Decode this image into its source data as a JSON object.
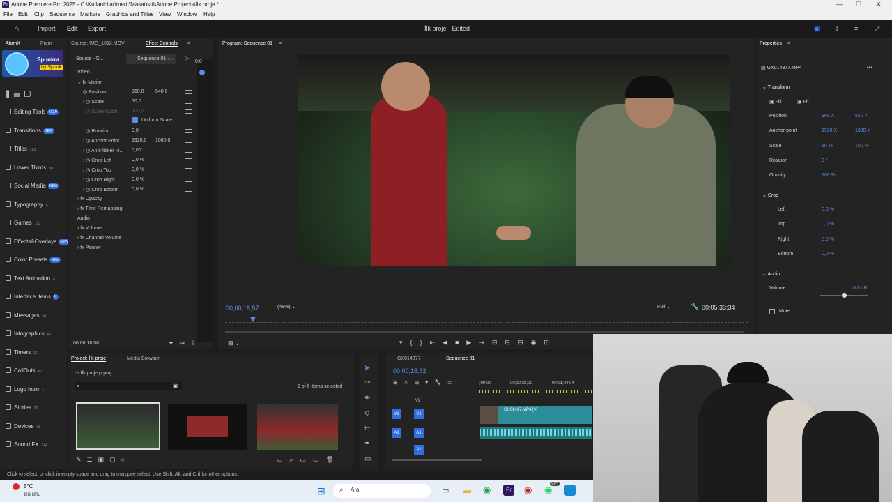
{
  "window": {
    "title": "Adobe Premiere Pro 2025 - C:\\Kullanicilar\\mertt\\Masaüstü\\Adobe Projects\\İlk proje *"
  },
  "menu": [
    "File",
    "Edit",
    "Clip",
    "Sequence",
    "Markers",
    "Graphics and Titles",
    "View",
    "Window",
    "Help"
  ],
  "header": {
    "import": "Import",
    "edit": "Edit",
    "export": "Export",
    "project_title": "İlk proje - Edited"
  },
  "atomx": {
    "tab": "AtomX",
    "tab2": "Prem",
    "banner_title": "Spunkra",
    "banner_sub": "by Spunk",
    "items": [
      {
        "label": "Editing Tools",
        "count": "",
        "badge": "NEW"
      },
      {
        "label": "Transitions",
        "count": "",
        "badge": "NEW"
      },
      {
        "label": "Titles",
        "count": "123",
        "badge": ""
      },
      {
        "label": "Lower Thirds",
        "count": "80",
        "badge": ""
      },
      {
        "label": "Social Media",
        "count": "",
        "badge": "NEW"
      },
      {
        "label": "Typography",
        "count": "67",
        "badge": ""
      },
      {
        "label": "Games",
        "count": "193",
        "badge": ""
      },
      {
        "label": "Effects&Overlays",
        "count": "",
        "badge": "NEW"
      },
      {
        "label": "Color Presets",
        "count": "",
        "badge": "NEW"
      },
      {
        "label": "Text Animation",
        "count": "4",
        "badge": ""
      },
      {
        "label": "Interface Items",
        "count": "",
        "badge": "N"
      },
      {
        "label": "Messages",
        "count": "54",
        "badge": ""
      },
      {
        "label": "Infographics",
        "count": "40",
        "badge": ""
      },
      {
        "label": "Timers",
        "count": "16",
        "badge": ""
      },
      {
        "label": "CallOuts",
        "count": "67",
        "badge": ""
      },
      {
        "label": "Logo Intro",
        "count": "4",
        "badge": ""
      },
      {
        "label": "Stories",
        "count": "10",
        "badge": ""
      },
      {
        "label": "Devices",
        "count": "35",
        "badge": ""
      },
      {
        "label": "Sound FX",
        "count": "244",
        "badge": ""
      }
    ]
  },
  "effect_controls": {
    "tab_source": "Source: IMG_1012.MOV",
    "tab_ec": "Effect Controls",
    "src_clip": "Source - G...",
    "seq": "Sequence 01 -...",
    "video": "Video",
    "motion": "Motion",
    "rows": [
      {
        "label": "Position",
        "v1": "960,0",
        "v2": "540,0"
      },
      {
        "label": "Scale",
        "v1": "50,0",
        "v2": ""
      },
      {
        "label": "Scale Width",
        "v1": "100,0",
        "v2": ""
      },
      {
        "label": "Rotation",
        "v1": "0,0",
        "v2": ""
      },
      {
        "label": "Anchor Point",
        "v1": "1920,0",
        "v2": "1080,0"
      },
      {
        "label": "Anti-flicker Fi...",
        "v1": "0,00",
        "v2": ""
      },
      {
        "label": "Crop Left",
        "v1": "0,0 %",
        "v2": ""
      },
      {
        "label": "Crop Top",
        "v1": "0,0 %",
        "v2": ""
      },
      {
        "label": "Crop Right",
        "v1": "0,0 %",
        "v2": ""
      },
      {
        "label": "Crop Bottom",
        "v1": "0,0 %",
        "v2": ""
      }
    ],
    "uniform": "Uniform Scale",
    "opacity": "Opacity",
    "time_remap": "Time Remapping",
    "audio": "Audio",
    "volume": "Volume",
    "channel_volume": "Channel Volume",
    "panner": "Panner",
    "timecode": "00;00;18;58",
    "zero": "0;0"
  },
  "program": {
    "title": "Program: Sequence 01",
    "timecode": "00;00;18;57",
    "zoom": "(48%)",
    "quality": "Full",
    "duration": "00;05;33;34"
  },
  "properties": {
    "title": "Properties",
    "clip": "GX014377.MP4",
    "transform": "Transform",
    "fill": "Fill",
    "fit": "Fit",
    "rows": [
      {
        "label": "Position",
        "v1": "960 X",
        "v2": "540 Y"
      },
      {
        "label": "Anchor point",
        "v1": "1920 X",
        "v2": "1080 Y"
      },
      {
        "label": "Scale",
        "v1": "50 %",
        "v2": "100 %"
      },
      {
        "label": "Rotation",
        "v1": "0 °",
        "v2": ""
      },
      {
        "label": "Opacity",
        "v1": "100 %",
        "v2": ""
      }
    ],
    "crop": "Crop",
    "crop_rows": [
      {
        "label": "Left",
        "v": "0,0 %"
      },
      {
        "label": "Top",
        "v": "0,0 %"
      },
      {
        "label": "Right",
        "v": "0,0 %"
      },
      {
        "label": "Bottom",
        "v": "0,0 %"
      }
    ],
    "audio": "Audio",
    "volume": "Volume",
    "volume_v": "0,0 dB",
    "mute": "Mute",
    "volume_level": 0.5
  },
  "project": {
    "tab": "Project: İlk proje",
    "tab2": "Media Browser",
    "file": "İlk proje.prproj",
    "selected": "1 of 6 items selected"
  },
  "timeline": {
    "tab1": "GX014377",
    "tab2": "Sequence 01",
    "timecode": "00;00;18;52",
    "r1": ";00;00",
    "r2": "00;00;32;00",
    "r3": "00;01;04;04",
    "v2": "V2",
    "v1": "V1",
    "a1": "A1",
    "a2": "A2",
    "clip": "GX01437.MP4 [V]"
  },
  "status": {
    "text": "Click to select, or click in empty space and drag to marquee select. Use Shift, Alt, and Ctrl for other options."
  },
  "taskbar": {
    "temp": "5°C",
    "weather": "Bulutlu",
    "search": "Ara",
    "badge": "99+"
  }
}
